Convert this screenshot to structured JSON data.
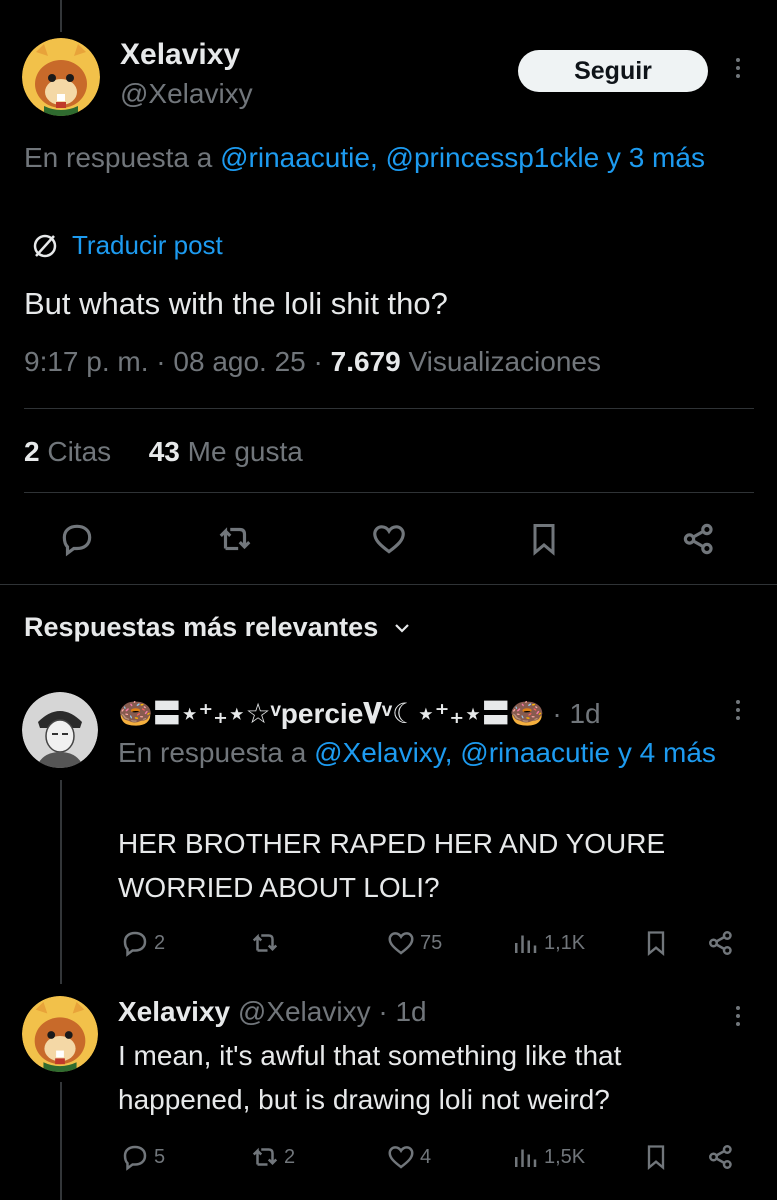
{
  "main_tweet": {
    "name": "Xelavixy",
    "handle": "@Xelavixy",
    "follow_label": "Seguir",
    "reply_prefix": "En respuesta a ",
    "reply_mentions": "@rinaacutie, @princessp1ckle y 3 más",
    "translate_label": "Traducir post",
    "text": "But whats with the loli shit tho?",
    "time": "9:17 p. m. · 08 ago. 25 · ",
    "views_count": "7.679",
    "views_label": " Visualizaciones",
    "quotes_count": "2",
    "quotes_label": " Citas",
    "likes_count": "43",
    "likes_label": " Me gusta"
  },
  "replies_section": {
    "title": "Respuestas más relevantes"
  },
  "reply1": {
    "name": "🍩〓⋆⁺₊⋆☆ᵛpercie𝐕ᵛ☾⋆⁺₊⋆〓🍩",
    "time": " · 1d",
    "reply_prefix": "En respuesta a ",
    "reply_mentions": "@Xelavixy, @rinaacutie y 4 más",
    "text": "HER BROTHER RAPED HER AND YOURE WORRIED ABOUT LOLI?",
    "replies": "2",
    "retweets": "",
    "likes": "75",
    "views": "1,1K"
  },
  "reply2": {
    "name": "Xelavixy",
    "handle": " @Xelavixy · 1d",
    "text": "I mean, it's awful that something like that happened, but is drawing loli not weird?",
    "replies": "5",
    "retweets": "2",
    "likes": "4",
    "views": "1,5K"
  },
  "colors": {
    "background": "#000000",
    "text_primary": "#e7e9ea",
    "text_secondary": "#71767b",
    "link": "#1d9bf0",
    "divider": "#2f3336"
  }
}
